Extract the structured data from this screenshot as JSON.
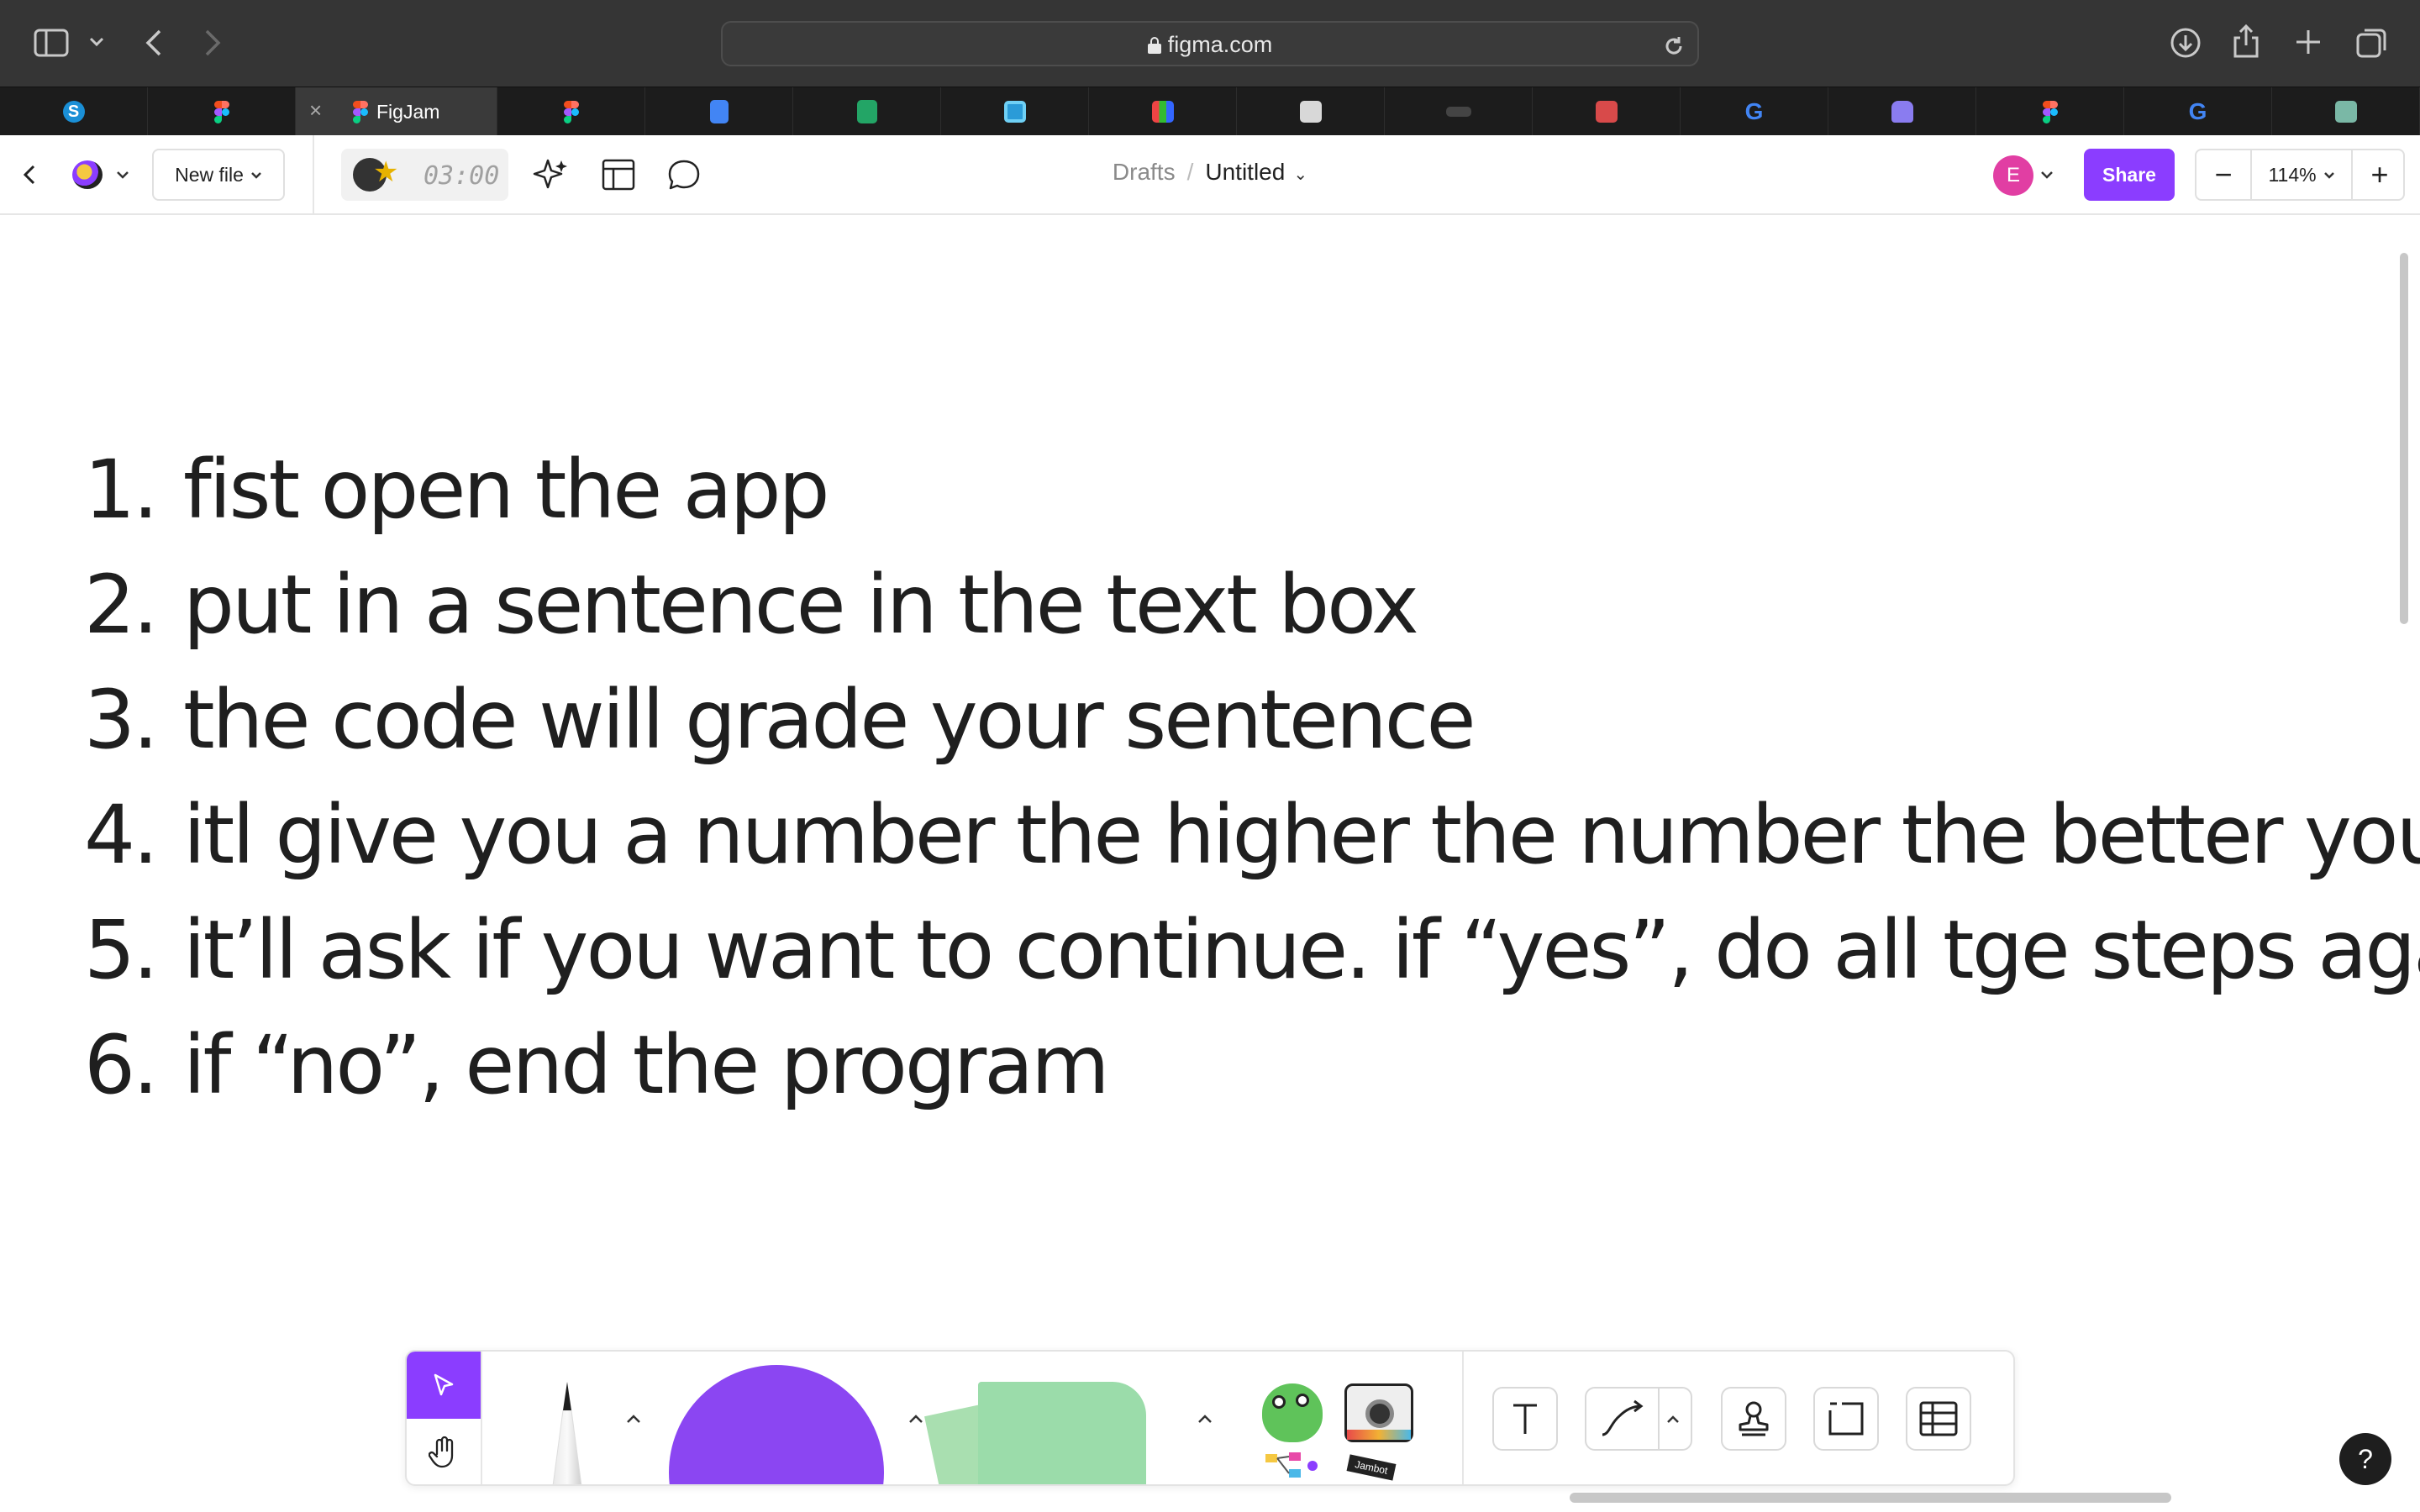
{
  "browser": {
    "url": "figma.com",
    "tabs": [
      {
        "icon": "skype-icon",
        "title": ""
      },
      {
        "icon": "figma-icon",
        "title": ""
      },
      {
        "icon": "figma-icon",
        "title": "FigJam",
        "active": true
      },
      {
        "icon": "figma-icon",
        "title": ""
      },
      {
        "icon": "google-docs-icon",
        "title": ""
      },
      {
        "icon": "google-sheets-icon",
        "title": ""
      },
      {
        "icon": "blue-square-icon",
        "title": ""
      },
      {
        "icon": "grid-app-icon",
        "title": ""
      },
      {
        "icon": "pencil-app-icon",
        "title": ""
      },
      {
        "icon": "dark-app-icon",
        "title": ""
      },
      {
        "icon": "red-app-icon",
        "title": ""
      },
      {
        "icon": "google-icon",
        "title": ""
      },
      {
        "icon": "purple-app-icon",
        "title": ""
      },
      {
        "icon": "figma-icon",
        "title": ""
      },
      {
        "icon": "google-icon",
        "title": ""
      },
      {
        "icon": "chatgpt-icon",
        "title": ""
      }
    ]
  },
  "toolbar": {
    "new_file_label": "New file",
    "timer": "03:00",
    "breadcrumb_parent": "Drafts",
    "breadcrumb_separator": "/",
    "file_title": "Untitled",
    "avatar_initial": "E",
    "share_label": "Share",
    "zoom_level": "114%",
    "zoom_out_label": "−",
    "zoom_in_label": "+"
  },
  "canvas": {
    "steps": [
      {
        "num": "1.",
        "text": "fist open the app"
      },
      {
        "num": "2.",
        "text": "put in a sentence in the text box"
      },
      {
        "num": "3.",
        "text": "the code will grade your sentence"
      },
      {
        "num": "4.",
        "text": "itl give you a number the higher the number the better your rizz"
      },
      {
        "num": "5.",
        "text": "it’ll ask if you want to continue. if “yes”, do all tge steps again."
      },
      {
        "num": "6.",
        "text": "if “no”, end the program"
      }
    ],
    "help_label": "?"
  },
  "dock": {
    "sticker_tag": "Jambot"
  },
  "colors": {
    "accent": "#8b3dff",
    "avatar": "#e13ea3",
    "chrome": "#353535",
    "sticky": "#9bdcaa"
  }
}
